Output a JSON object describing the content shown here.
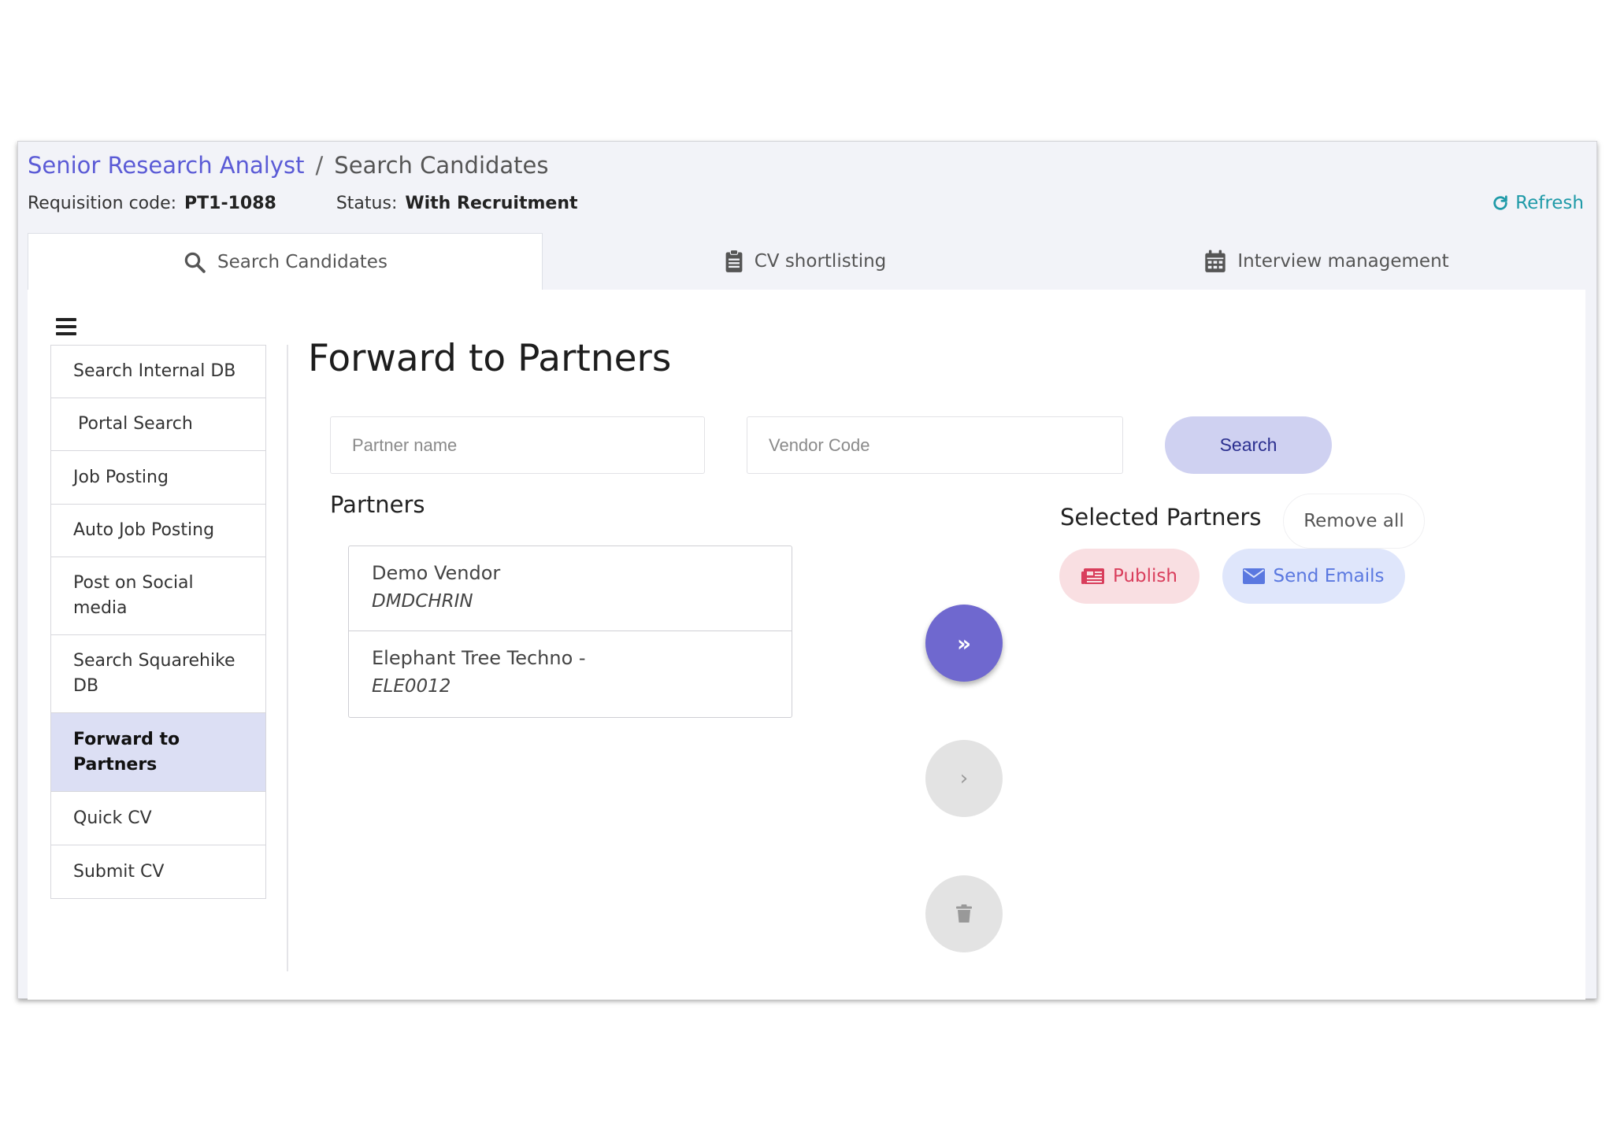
{
  "breadcrumb": {
    "parent": "Senior Research Analyst",
    "separator": "/",
    "current": "Search Candidates"
  },
  "meta": {
    "requisition_label": "Requisition code:",
    "requisition_value": "PT1-1088",
    "status_label": "Status:",
    "status_value": "With Recruitment"
  },
  "refresh_label": "Refresh",
  "tabs": [
    {
      "label": "Search Candidates",
      "icon": "search-icon",
      "active": true
    },
    {
      "label": "CV shortlisting",
      "icon": "clipboard-icon",
      "active": false
    },
    {
      "label": "Interview management",
      "icon": "calendar-icon",
      "active": false
    }
  ],
  "sidebar": {
    "items": [
      {
        "label": "Search Internal DB"
      },
      {
        "label": "Portal Search"
      },
      {
        "label": "Job Posting"
      },
      {
        "label": "Auto Job Posting"
      },
      {
        "label": "Post on Social media"
      },
      {
        "label": "Search Squarehike DB"
      },
      {
        "label": "Forward to Partners",
        "active": true
      },
      {
        "label": "Quick CV"
      },
      {
        "label": "Submit CV"
      }
    ]
  },
  "main": {
    "title": "Forward to Partners",
    "partner_name_placeholder": "Partner name",
    "vendor_code_placeholder": "Vendor Code",
    "search_label": "Search",
    "partners_heading": "Partners",
    "partners": [
      {
        "name": "Demo Vendor",
        "code": "DMDCHRIN"
      },
      {
        "name": "Elephant Tree Techno -",
        "code": "ELE0012"
      }
    ],
    "move_all_label": "»",
    "move_one_label": "›",
    "selected_heading": "Selected Partners",
    "remove_all_label": "Remove all",
    "publish_label": "Publish",
    "send_emails_label": "Send Emails"
  },
  "colors": {
    "accent": "#5b5bd6",
    "refresh": "#1f9aa8",
    "active_bg": "#dcdff4",
    "publish": "#d93e5c",
    "send": "#5a78e0"
  }
}
